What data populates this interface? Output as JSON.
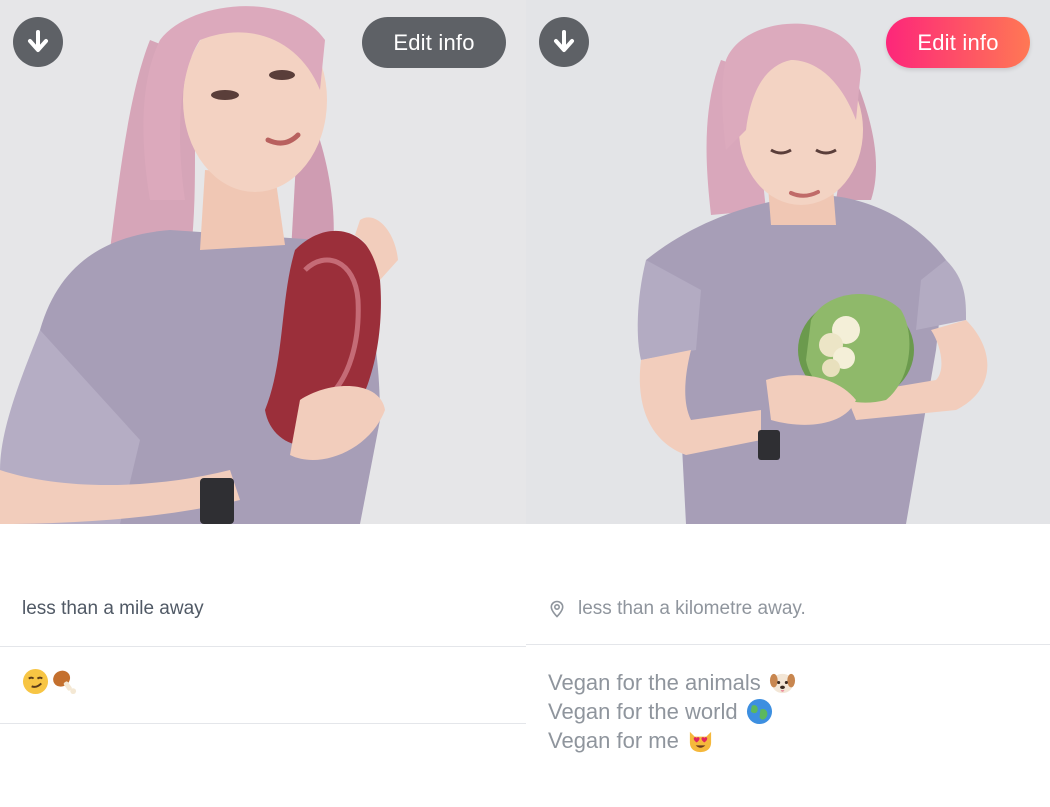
{
  "left_profile": {
    "edit_label": "Edit info",
    "download_icon": "arrow-down-icon",
    "distance": "less than a mile away",
    "bio_emojis": [
      "smirking-face-emoji",
      "poultry-leg-emoji"
    ],
    "photo_subject": "woman holding raw steak"
  },
  "right_profile": {
    "edit_label": "Edit info",
    "download_icon": "arrow-down-icon",
    "location_icon": "map-pin-icon",
    "distance": "less than a kilometre away.",
    "bio_lines": [
      {
        "text": "Vegan for the animals",
        "emoji": "dog-face-emoji"
      },
      {
        "text": "Vegan for the world",
        "emoji": "globe-emoji"
      },
      {
        "text": "Vegan for me",
        "emoji": "heart-eyes-cat-emoji"
      }
    ],
    "photo_subject": "woman holding cauliflower"
  },
  "colors": {
    "button_grey": "#5e6166",
    "gradient_start": "#fd267a",
    "gradient_end": "#ff7854",
    "text_dark": "#505965",
    "text_light": "#8f959d"
  }
}
